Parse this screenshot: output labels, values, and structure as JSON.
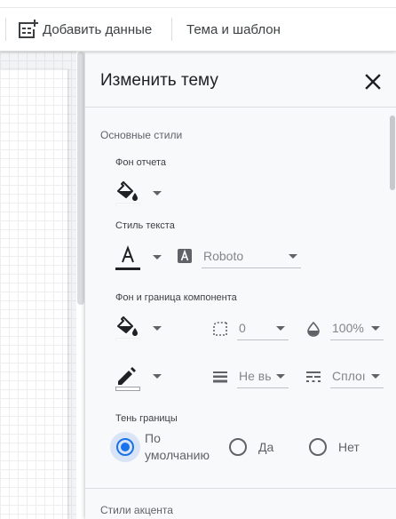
{
  "toolbar": {
    "add_data_label": "Добавить данные",
    "theme_label": "Тема и шаблон"
  },
  "panel": {
    "title": "Изменить тему",
    "close_icon": "close-icon",
    "basic_styles": {
      "label": "Основные стили",
      "report_background": {
        "label": "Фон отчета",
        "icon": "fill-color-icon",
        "color": "#ffffff"
      },
      "text_style": {
        "label": "Стиль текста",
        "color_icon": "text-color-icon",
        "color": "#202124",
        "font_icon": "font-icon",
        "font": "Roboto"
      },
      "component": {
        "label": "Фон и граница компонента",
        "fill_icon": "fill-color-icon",
        "fill_color": "#ffffff",
        "radius_icon": "border-radius-icon",
        "radius_value": "0",
        "opacity_icon": "opacity-icon",
        "opacity_value": "100%",
        "border_color_icon": "border-color-icon",
        "border_color": "#ffffff",
        "weight_icon": "line-weight-icon",
        "weight_value": "Не вь",
        "style_icon": "line-style-icon",
        "style_value": "Сплоı"
      },
      "shadow": {
        "label": "Тень границы",
        "options": [
          {
            "label": "По\nумолчанию",
            "checked": true
          },
          {
            "label": "Да",
            "checked": false
          },
          {
            "label": "Нет",
            "checked": false
          }
        ]
      }
    },
    "accent_styles": {
      "label": "Стили акцента"
    }
  },
  "colors": {
    "accent": "#1a73e8",
    "panel_bg": "#f8f9fa"
  }
}
